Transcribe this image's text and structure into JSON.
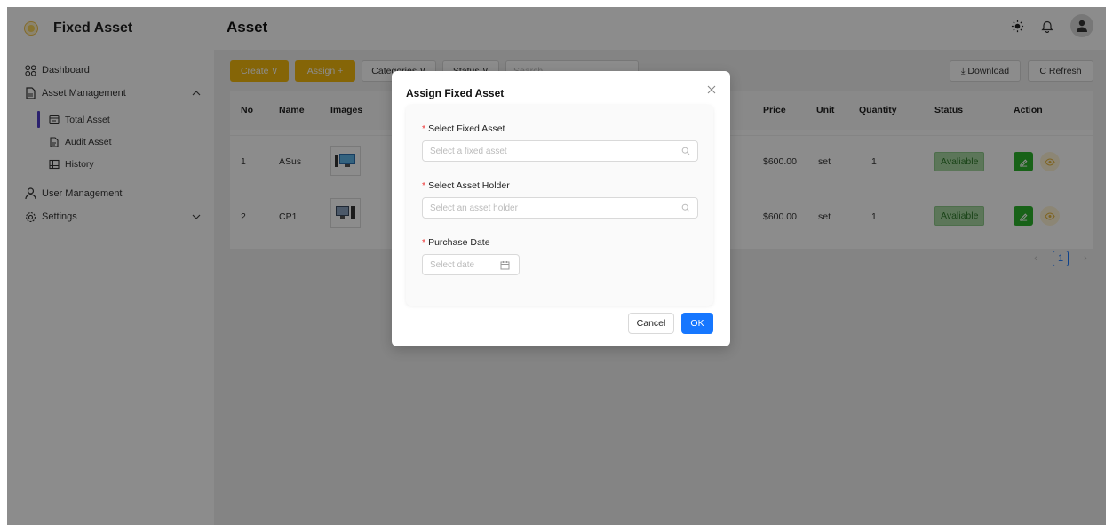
{
  "app": {
    "name": "Fixed Asset"
  },
  "sidebar": {
    "dashboard": "Dashboard",
    "asset_management": "Asset Management",
    "sub_items": [
      "Total Asset",
      "Audit Asset",
      "History"
    ],
    "user_management": "User Management",
    "settings": "Settings"
  },
  "header": {
    "title": "Asset"
  },
  "toolbar": {
    "create": "Create ∨",
    "assign": "Assign +",
    "categories": "Categories ∨",
    "status": "Status ∨",
    "search_placeholder": "Search",
    "download": "⤓ Download",
    "refresh": "C Refresh"
  },
  "table": {
    "columns": [
      "No",
      "Name",
      "Images",
      "Price",
      "Unit",
      "Quantity",
      "Status",
      "Action"
    ],
    "rows": [
      {
        "no": "1",
        "name": "ASus",
        "price": "$600.00",
        "unit": "set",
        "quantity": "1",
        "status": "Avaliable"
      },
      {
        "no": "2",
        "name": "CP1",
        "price": "$600.00",
        "unit": "set",
        "quantity": "1",
        "status": "Avaliable"
      }
    ]
  },
  "pagination": {
    "current": "1"
  },
  "modal": {
    "title": "Assign Fixed Asset",
    "fields": [
      {
        "label": "Select Fixed Asset",
        "placeholder": "Select a fixed asset"
      },
      {
        "label": "Select Asset Holder",
        "placeholder": "Select an asset holder"
      },
      {
        "label": "Purchase Date",
        "placeholder": "Select date"
      }
    ],
    "cancel": "Cancel",
    "ok": "OK"
  },
  "colors": {
    "accent_yellow": "#f2b90d",
    "primary_blue": "#1677ff",
    "status_green": "#a8d8a3",
    "edit_green": "#2db32d"
  }
}
